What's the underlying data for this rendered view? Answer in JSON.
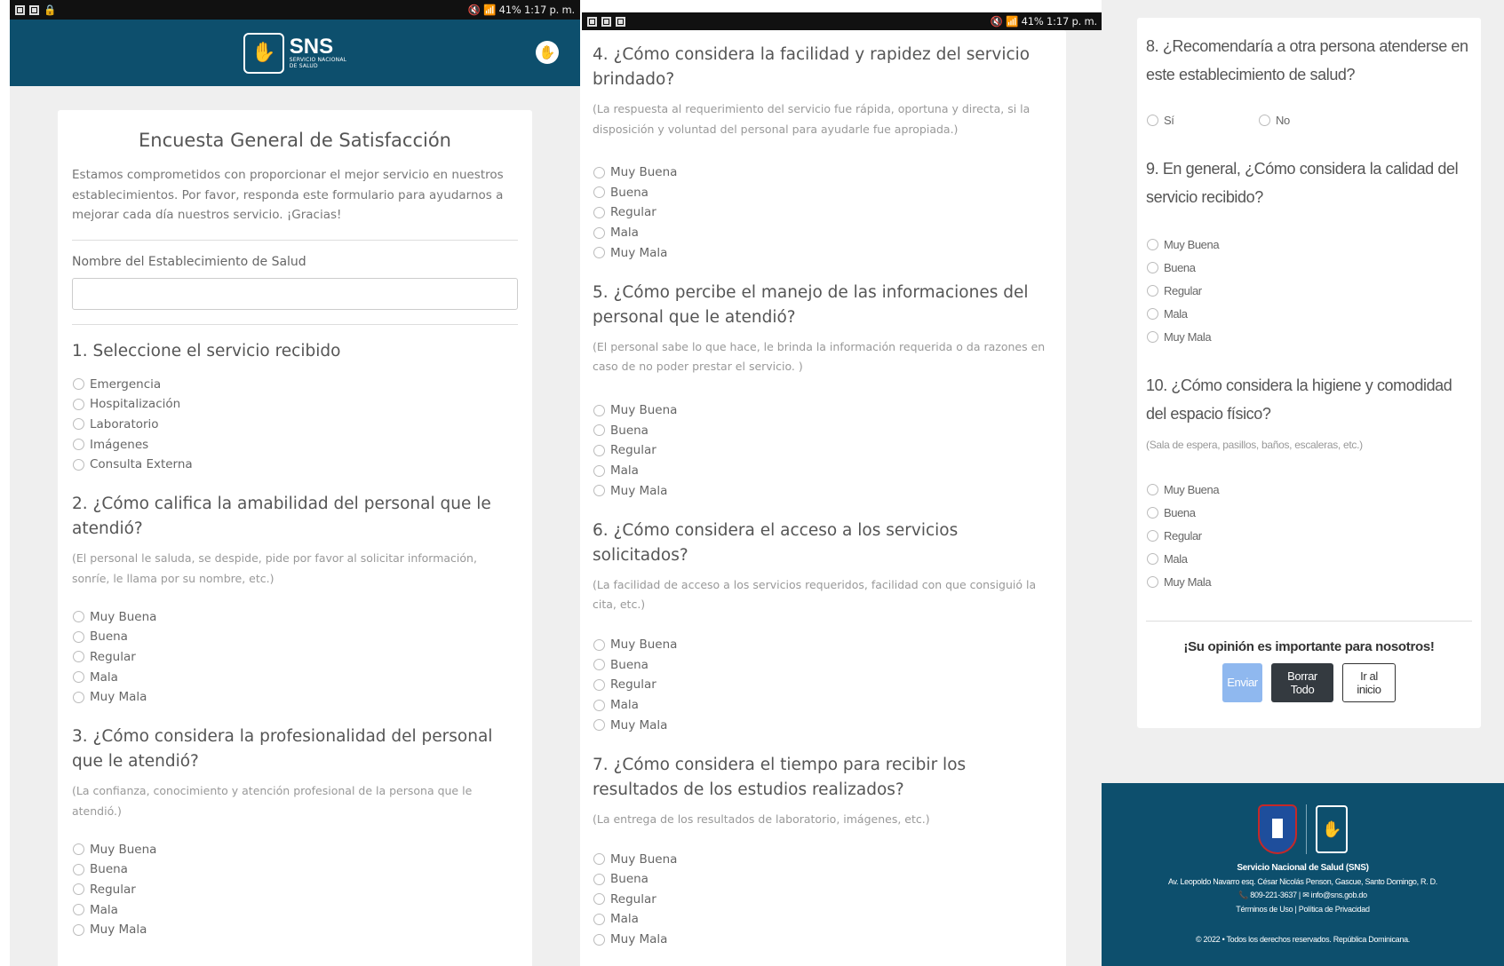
{
  "status": {
    "left_time": "41% 1:17 p. m.",
    "mid_time": "41% 1:17 p. m."
  },
  "brand": {
    "name": "SNS",
    "tagline1": "SERVICIO NACIONAL",
    "tagline2": "DE SALUD"
  },
  "survey": {
    "title": "Encuesta General de Satisfacción",
    "intro": "Estamos comprometidos con proporcionar el mejor servicio en nuestros establecimientos. Por favor, responda este formulario para ayudarnos a mejorar cada día nuestros servicio. ¡Gracias!",
    "facility_label": "Nombre del Establecimiento de Salud",
    "facility_value": ""
  },
  "rating_options": [
    "Muy Buena",
    "Buena",
    "Regular",
    "Mala",
    "Muy Mala"
  ],
  "questions": {
    "q1": {
      "text": "1. Seleccione el servicio recibido",
      "options": [
        "Emergencia",
        "Hospitalización",
        "Laboratorio",
        "Imágenes",
        "Consulta Externa"
      ]
    },
    "q2": {
      "text": "2. ¿Cómo califica la amabilidad del personal que le atendió?",
      "hint": "(El personal le saluda, se despide, pide por favor al solicitar información, sonríe, le llama por su nombre, etc.)"
    },
    "q3": {
      "text": "3. ¿Cómo considera la profesionalidad del personal que le atendió?",
      "hint": "(La confianza, conocimiento y atención profesional de la persona que le atendió.)"
    },
    "q4": {
      "text": "4. ¿Cómo considera la facilidad y rapidez del servicio brindado?",
      "hint": "(La respuesta al requerimiento del servicio fue rápida, oportuna y directa, si la disposición y voluntad del personal para ayudarle fue apropiada.)"
    },
    "q5": {
      "text": "5. ¿Cómo percibe el manejo de las informaciones del personal que le atendió?",
      "hint": "(El personal sabe lo que hace, le brinda la información requerida o da razones en caso de no poder prestar el servicio. )"
    },
    "q6": {
      "text": "6. ¿Cómo considera el acceso a los servicios solicitados?",
      "hint": "(La facilidad de acceso a los servicios requeridos, facilidad con que consiguió la cita, etc.)"
    },
    "q7": {
      "text": "7. ¿Cómo considera el tiempo para recibir los resultados de los estudios realizados?",
      "hint": "(La entrega de los resultados de laboratorio, imágenes, etc.)"
    },
    "q8": {
      "text": "8. ¿Recomendaría a otra persona atenderse en este establecimiento de salud?",
      "options": [
        "Sí",
        "No"
      ]
    },
    "q9": {
      "text": "9. En general, ¿Cómo considera la calidad del servicio recibido?"
    },
    "q10": {
      "text": "10. ¿Cómo considera la higiene y comodidad del espacio físico?",
      "hint": "(Sala de espera, pasillos, baños, escaleras, etc.)"
    }
  },
  "closing": {
    "message": "¡Su opinión es importante para nosotros!",
    "send_label": "Enviar",
    "clear_label": "Borrar Todo",
    "home_label": "Ir al inicio"
  },
  "footer": {
    "org_name": "Servicio Nacional de Salud (SNS)",
    "address": "Av. Leopoldo Navarro esq. César Nicolás Penson, Gascue, Santo Domingo, R. D.",
    "phone": "809-221-3637",
    "email": "info@sns.gob.do",
    "terms": "Términos de Uso",
    "privacy": "Política de Privacidad",
    "copyright": "© 2022 • Todos los derechos reservados. República Dominicana."
  }
}
